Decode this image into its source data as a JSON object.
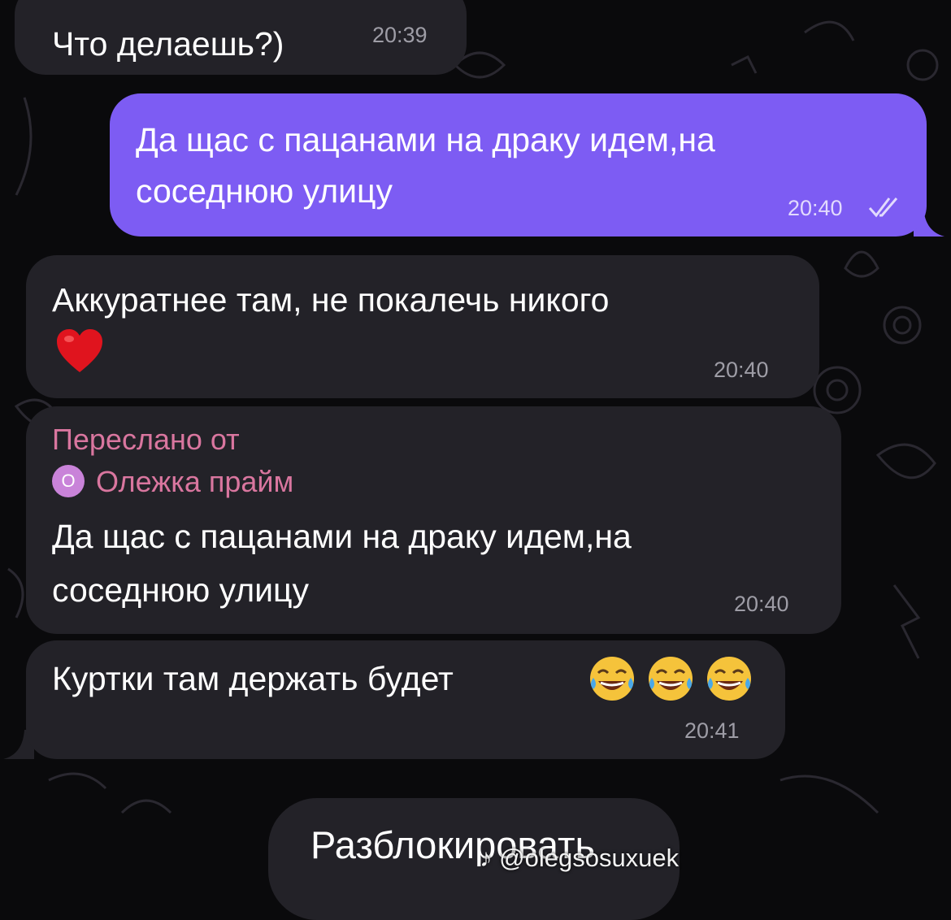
{
  "messages": [
    {
      "text": "Что делаешь?)",
      "time": "20:39"
    },
    {
      "lines": [
        "Да щас с пацанами на драку идем,на",
        "соседнюю улицу"
      ],
      "time": "20:40",
      "status_icon": "double-check-icon"
    },
    {
      "text": "Аккуратнее там, не покалечь никого",
      "emoji": "red-heart",
      "time": "20:40"
    },
    {
      "forwarded_label": "Переслано от",
      "forwarded_avatar": "О",
      "forwarded_name": "Олежка прайм",
      "lines": [
        "Да щас с пацанами на драку идем,на",
        "соседнюю улицу"
      ],
      "time": "20:40"
    },
    {
      "text": "Куртки там держать будет",
      "emoji": "face-with-tears-of-joy x3",
      "time": "20:41"
    }
  ],
  "unblock_button": {
    "label": "Разблокировать"
  },
  "watermark": {
    "text": "@olegsosuxuek",
    "icon": "tiktok-icon"
  },
  "colors": {
    "background": "#0a0a0c",
    "incoming_bubble": "#232228",
    "outgoing_bubble": "#7d5cf3",
    "forward_accent": "#d9769f"
  }
}
